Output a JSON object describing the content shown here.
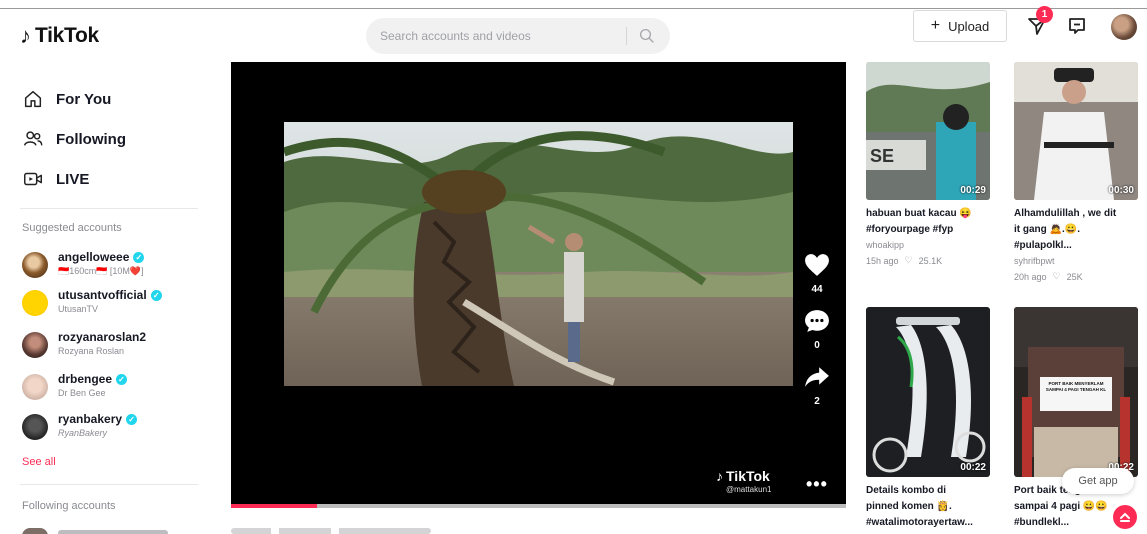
{
  "header": {
    "logo_text": "TikTok",
    "search_placeholder": "Search accounts and videos",
    "upload_label": "Upload",
    "notification_count": "1"
  },
  "sidebar": {
    "nav": [
      {
        "label": "For You",
        "icon": "home-icon"
      },
      {
        "label": "Following",
        "icon": "users-icon"
      },
      {
        "label": "LIVE",
        "icon": "live-icon"
      }
    ],
    "suggested_title": "Suggested accounts",
    "suggested": [
      {
        "username": "angelloweee",
        "nickname": "🇮🇩160cm🇮🇩 [10M❤️]",
        "verified": true
      },
      {
        "username": "utusantvofficial",
        "nickname": "UtusanTV",
        "verified": true
      },
      {
        "username": "rozyanaroslan2",
        "nickname": "Rozyana Roslan",
        "verified": false
      },
      {
        "username": "drbengee",
        "nickname": "Dr Ben Gee",
        "verified": true
      },
      {
        "username": "ryanbakery",
        "nickname": "RyanBakery",
        "verified": true
      }
    ],
    "see_all": "See all",
    "following_title": "Following accounts"
  },
  "player": {
    "likes": "44",
    "comments": "0",
    "shares": "2",
    "watermark_brand": "TikTok",
    "watermark_user": "@mattakun1",
    "progress_percent": 14
  },
  "grid": [
    {
      "caption": "habuan buat kacau 😝",
      "tags": "#foryourpage #fyp",
      "author": "whoakipp",
      "time": "15h ago",
      "likes": "25.1K",
      "duration": "00:29"
    },
    {
      "caption": "Alhamdulillah , we dit",
      "caption2": "it gang 🙇.😀.",
      "tags": "#pulapolkl...",
      "author": "syhrifbpwt",
      "time": "20h ago",
      "likes": "25K",
      "duration": "00:30"
    },
    {
      "caption": "Details kombo di",
      "caption2": "pinned komen 👸.",
      "tags": "#watalimotorayertaw...",
      "duration": "00:22"
    },
    {
      "caption": "Port baik tengah",
      "caption2": "sampai 4 pagi 😀😀",
      "tags": "#bundlekl...",
      "duration": "00:22",
      "overlay_text": "PORT BAIK MENYERLAM SAMPAI 4 PAGI TENGAH KL"
    }
  ],
  "get_app": "Get app",
  "colors": {
    "brand": "#fe2c55",
    "verified": "#20d5ec"
  }
}
